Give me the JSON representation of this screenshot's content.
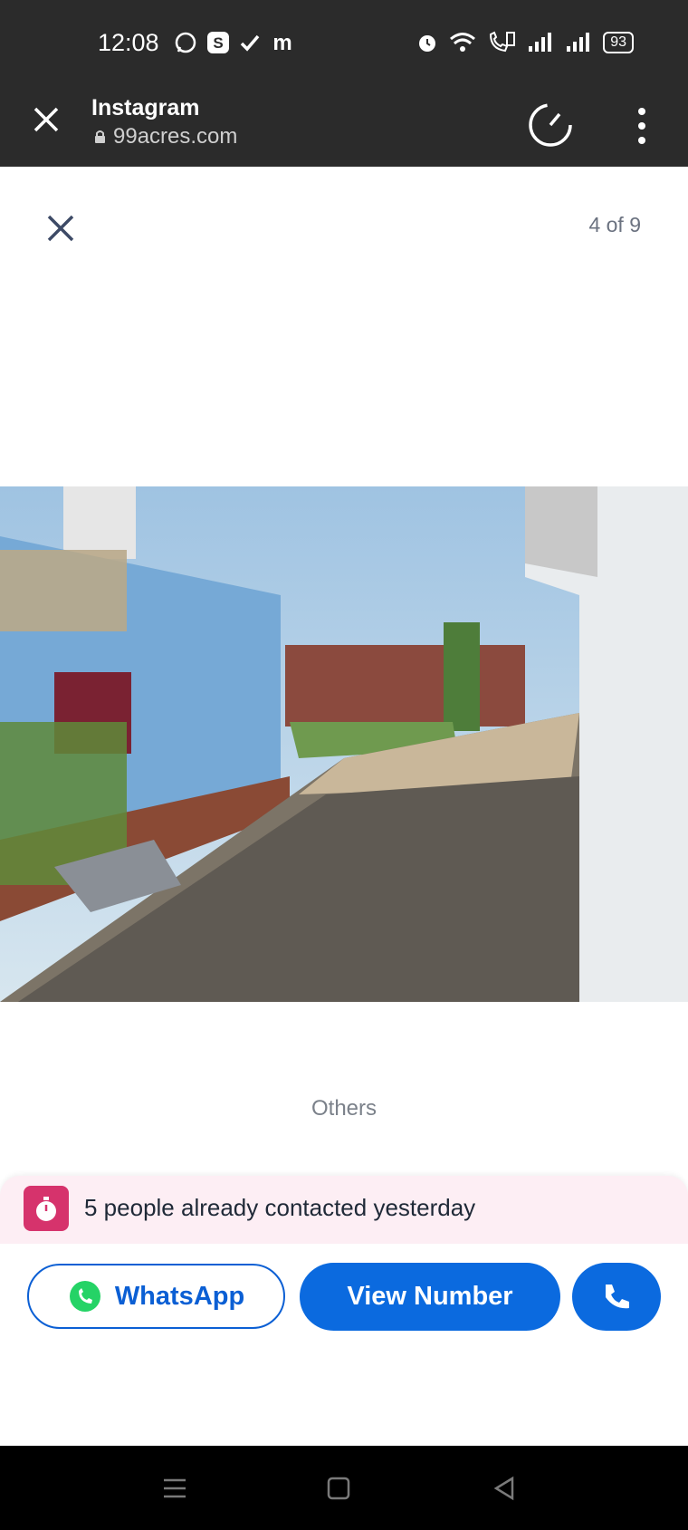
{
  "status_bar": {
    "time": "12:08",
    "battery": "93"
  },
  "browser": {
    "title": "Instagram",
    "url": "99acres.com"
  },
  "viewer": {
    "counter": "4 of 9",
    "caption": "Others"
  },
  "banner": {
    "text": "5 people already contacted yesterday"
  },
  "actions": {
    "whatsapp_label": "WhatsApp",
    "view_number_label": "View Number"
  },
  "colors": {
    "primary": "#0b6adf",
    "banner_bg": "#fdeef4",
    "badge": "#d6336c",
    "whatsapp_green": "#25d366"
  },
  "icons": [
    "whatsapp-icon",
    "s-app-icon",
    "check-icon",
    "m-app-icon",
    "alarm-icon",
    "wifi-icon",
    "call-icon",
    "signal-icon",
    "battery-icon",
    "close-icon",
    "lock-icon",
    "speed-icon",
    "more-icon",
    "stopwatch-icon",
    "phone-icon",
    "menu-icon",
    "home-icon",
    "back-icon"
  ]
}
